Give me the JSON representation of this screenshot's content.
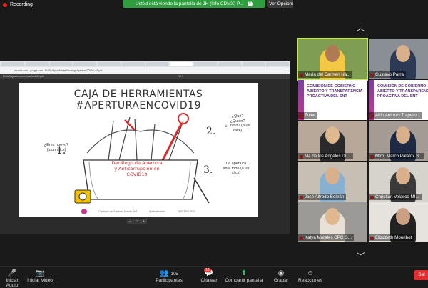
{
  "recording": {
    "label": "Recording"
  },
  "banner": {
    "text": "Usted está viendo la pantalla de JH (Info CDMX) P...",
    "close_glyph": "x"
  },
  "view_options": {
    "label": "Ver Opciones"
  },
  "view_toggle": {
    "label": "V"
  },
  "browser": {
    "url": "moodle.com / google.com / RUTA/ApadMoldesDecalogoAperturaCOVID-AP.pdf",
    "pdf_name": "FlmiaCajasHerramientasCovid19.pdf",
    "page_info": "1 / 1"
  },
  "slide": {
    "title": "CAJA DE HERRAMIENTAS #APERTURAENCOVID19",
    "step1_label": "¿Eres nuevo? (a un click)",
    "step1_num": "1.",
    "step2_label": "¿Qué? ¿Quién? ¿Cómo? (a un click)",
    "step2_num": "2.",
    "step3_label": "La apertura ante todo (a un click)",
    "step3_num": "3.",
    "decalogo": "Decálogo de Apertura y Anticorrupción en COVID19",
    "footer_org": "Comisión de Gobierno Abierto SNT",
    "footer_handle": "@infoplenoinfo",
    "footer_date": "15 AT ENE 2021"
  },
  "zoom_controls": {
    "minus": "−",
    "fit": "□",
    "plus": "+"
  },
  "gallery": {
    "up": "︿",
    "down": "﹀",
    "tiles": [
      {
        "name": "María del Carmen Na...",
        "speaking": true
      },
      {
        "name": "Gustavo Parra",
        "speaking": false
      },
      {
        "name": "Zulee",
        "speaking": false,
        "banner": "COMISIÓN DE GOBIERNO ABIERTO Y TRANSPARENCIA PROACTIVA DEL SNT"
      },
      {
        "name": "Aldo Antonio Trapero...",
        "speaking": false,
        "banner": "COMISIÓN DE GOBIERNO ABIERTO Y TRANSPARENCIA PROACTIVA DEL SNT"
      },
      {
        "name": "Ma de los Angeles Du...",
        "speaking": false
      },
      {
        "name": "Mtro. Marco Palafox S...",
        "speaking": false
      },
      {
        "name": "José Alfredo Beltrán",
        "speaking": false
      },
      {
        "name": "Christian Velasco MI...",
        "speaking": false
      },
      {
        "name": "Katya Morales CPC G...",
        "speaking": false
      },
      {
        "name": "Elizabeth Monribot",
        "speaking": false
      }
    ]
  },
  "toolbar": {
    "audio": "Iniciar Audio",
    "video": "Iniciar Video",
    "participants": "Participantes",
    "participants_count": "105",
    "chat": "Chatear",
    "chat_badge": "18",
    "share": "Compartir pantalla",
    "record": "Grabar",
    "reactions": "Reacciones",
    "leave": "Sal"
  }
}
